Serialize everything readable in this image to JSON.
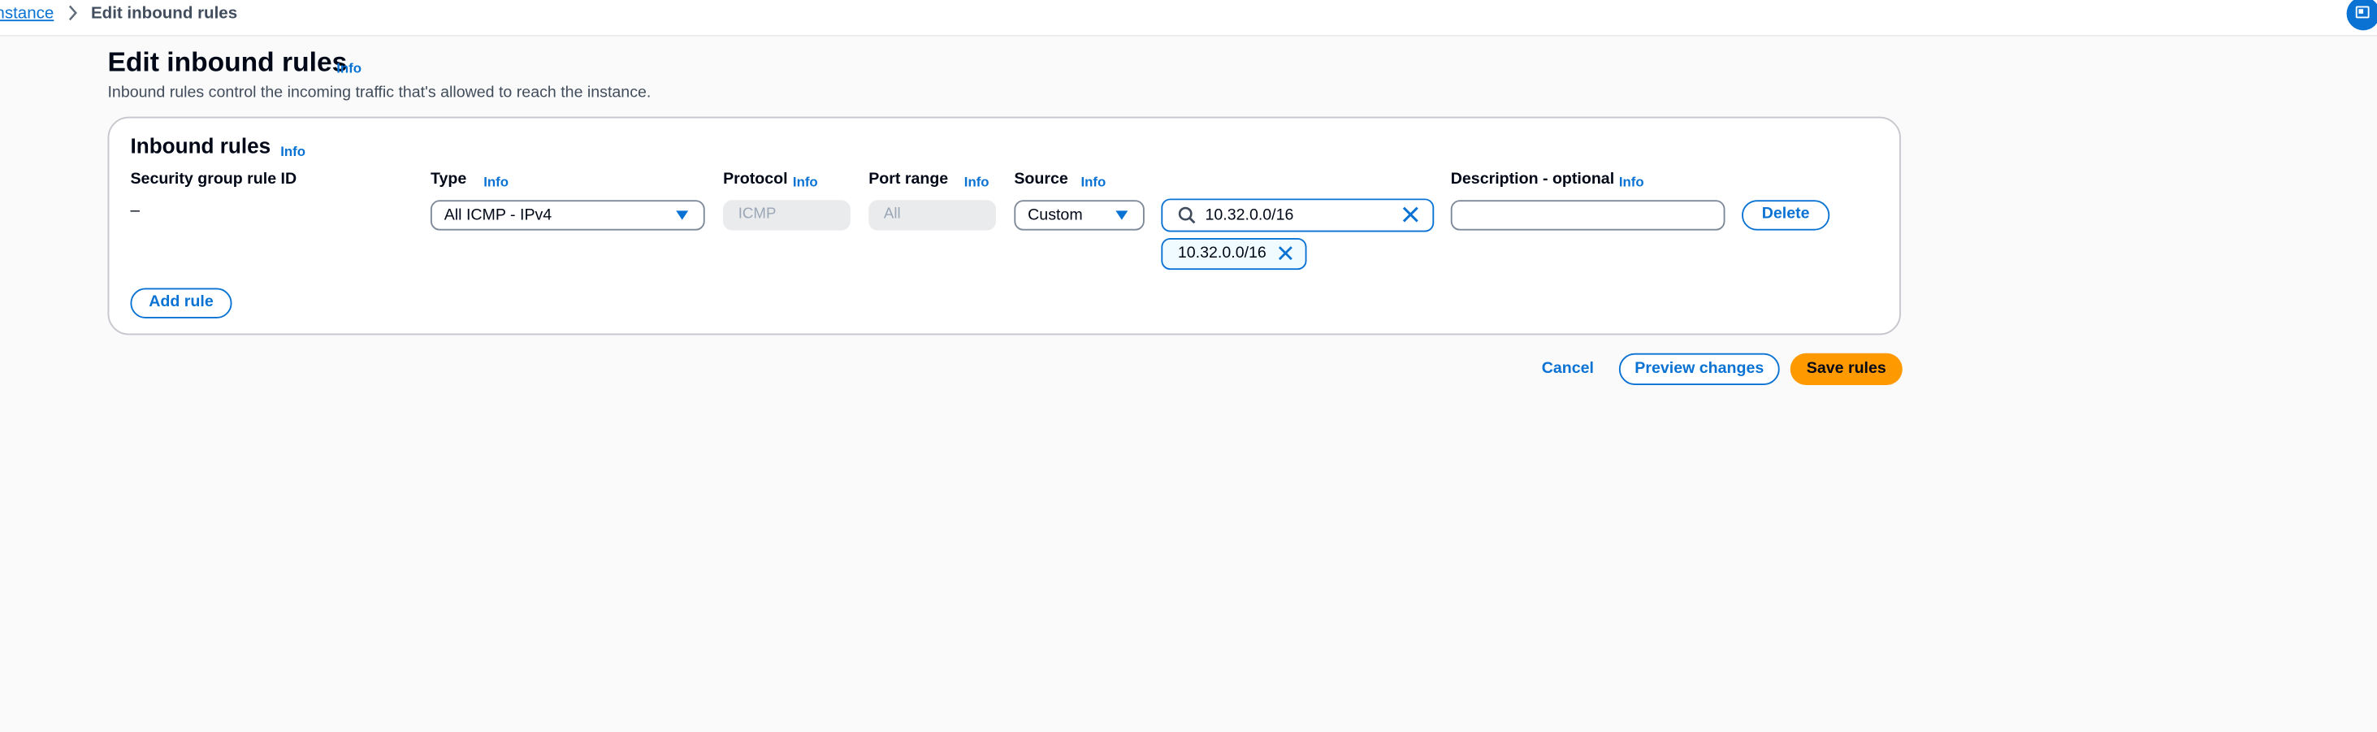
{
  "breadcrumb": {
    "parent": "nstance",
    "separator": ">",
    "current": "Edit inbound rules"
  },
  "page": {
    "title": "Edit inbound rules",
    "title_info": "Info",
    "description": "Inbound rules control the incoming traffic that's allowed to reach the instance."
  },
  "panel": {
    "title": "Inbound rules",
    "title_info": "Info",
    "columns": {
      "rule_id": "Security group rule ID",
      "type": "Type",
      "type_info": "Info",
      "protocol": "Protocol",
      "protocol_info": "Info",
      "port_range": "Port range",
      "port_range_info": "Info",
      "source": "Source",
      "source_info": "Info",
      "description": "Description - optional",
      "description_info": "Info"
    },
    "rule": {
      "rule_id": "–",
      "type": "All ICMP - IPv4",
      "protocol_placeholder": "ICMP",
      "port_range_placeholder": "All",
      "source": "Custom",
      "cidr_value": "10.32.0.0/16",
      "token": "10.32.0.0/16",
      "description": "",
      "delete_label": "Delete"
    },
    "add_rule_label": "Add rule"
  },
  "footer": {
    "cancel_label": "Cancel",
    "preview_label": "Preview changes",
    "save_label": "Save rules"
  },
  "colors": {
    "accent": "#0972d3",
    "primary_button": "#ff9900"
  }
}
